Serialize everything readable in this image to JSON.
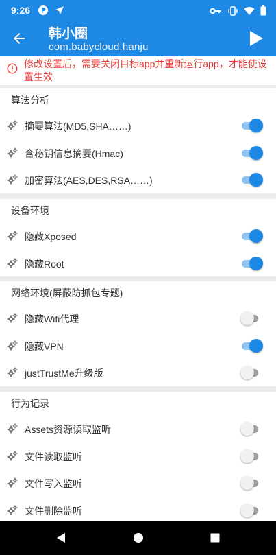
{
  "status_bar": {
    "time": "9:26",
    "icons": [
      "app-notification-icon",
      "location-arrow-icon",
      "vpn-key-icon",
      "vibrate-icon",
      "wifi-icon",
      "battery-icon"
    ]
  },
  "app_bar": {
    "title": "韩小圈",
    "subtitle": "com.babycloud.hanju",
    "back_icon": "arrow-back-icon",
    "action_icon": "play-icon"
  },
  "warning": {
    "icon": "error-icon",
    "text": "修改设置后，需要关闭目标app并重新运行app，才能使设置生效",
    "color": "#e53935"
  },
  "sections": [
    {
      "header": "算法分析",
      "items": [
        {
          "label": "摘要算法(MD5,SHA……)",
          "enabled": true
        },
        {
          "label": "含秘钥信息摘要(Hmac)",
          "enabled": true
        },
        {
          "label": "加密算法(AES,DES,RSA……)",
          "enabled": true
        }
      ]
    },
    {
      "header": "设备环境",
      "items": [
        {
          "label": "隐藏Xposed",
          "enabled": true
        },
        {
          "label": "隐藏Root",
          "enabled": true
        }
      ]
    },
    {
      "header": "网络环境(屏蔽防抓包专题)",
      "items": [
        {
          "label": "隐藏Wifi代理",
          "enabled": false
        },
        {
          "label": "隐藏VPN",
          "enabled": true
        },
        {
          "label": "justTrustMe升级版",
          "enabled": false
        }
      ]
    },
    {
      "header": "行为记录",
      "items": [
        {
          "label": "Assets资源读取监听",
          "enabled": false
        },
        {
          "label": "文件读取监听",
          "enabled": false
        },
        {
          "label": "文件写入监听",
          "enabled": false
        },
        {
          "label": "文件删除监听",
          "enabled": false
        }
      ]
    }
  ],
  "colors": {
    "primary": "#1e88e5",
    "switch_on_track": "#90c4f4",
    "switch_off_track": "#9e9e9e",
    "divider": "#ececec"
  },
  "nav_bar": {
    "buttons": [
      "back-triangle-icon",
      "home-circle-icon",
      "recents-square-icon"
    ]
  }
}
